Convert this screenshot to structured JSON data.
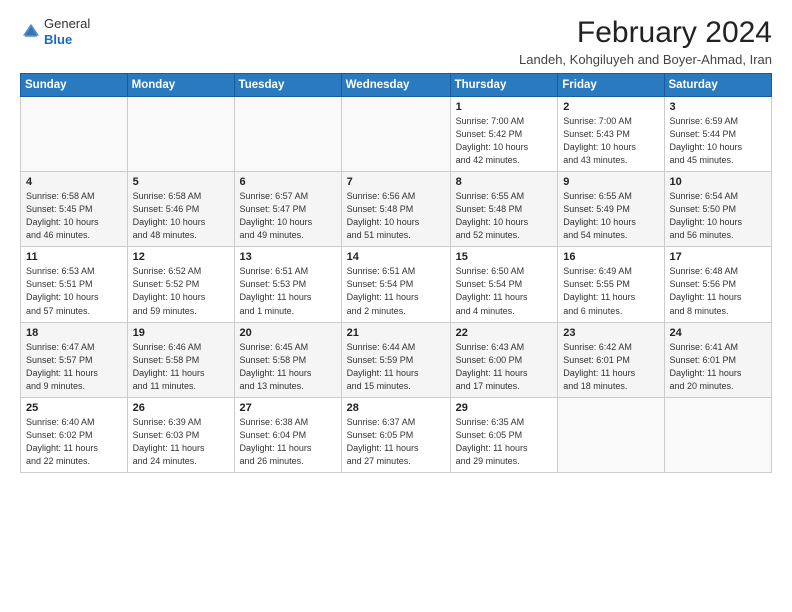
{
  "app": {
    "logo_line1": "General",
    "logo_line2": "Blue"
  },
  "header": {
    "title": "February 2024",
    "subtitle": "Landeh, Kohgiluyeh and Boyer-Ahmad, Iran"
  },
  "calendar": {
    "days_of_week": [
      "Sunday",
      "Monday",
      "Tuesday",
      "Wednesday",
      "Thursday",
      "Friday",
      "Saturday"
    ],
    "weeks": [
      [
        {
          "day": "",
          "info": ""
        },
        {
          "day": "",
          "info": ""
        },
        {
          "day": "",
          "info": ""
        },
        {
          "day": "",
          "info": ""
        },
        {
          "day": "1",
          "info": "Sunrise: 7:00 AM\nSunset: 5:42 PM\nDaylight: 10 hours\nand 42 minutes."
        },
        {
          "day": "2",
          "info": "Sunrise: 7:00 AM\nSunset: 5:43 PM\nDaylight: 10 hours\nand 43 minutes."
        },
        {
          "day": "3",
          "info": "Sunrise: 6:59 AM\nSunset: 5:44 PM\nDaylight: 10 hours\nand 45 minutes."
        }
      ],
      [
        {
          "day": "4",
          "info": "Sunrise: 6:58 AM\nSunset: 5:45 PM\nDaylight: 10 hours\nand 46 minutes."
        },
        {
          "day": "5",
          "info": "Sunrise: 6:58 AM\nSunset: 5:46 PM\nDaylight: 10 hours\nand 48 minutes."
        },
        {
          "day": "6",
          "info": "Sunrise: 6:57 AM\nSunset: 5:47 PM\nDaylight: 10 hours\nand 49 minutes."
        },
        {
          "day": "7",
          "info": "Sunrise: 6:56 AM\nSunset: 5:48 PM\nDaylight: 10 hours\nand 51 minutes."
        },
        {
          "day": "8",
          "info": "Sunrise: 6:55 AM\nSunset: 5:48 PM\nDaylight: 10 hours\nand 52 minutes."
        },
        {
          "day": "9",
          "info": "Sunrise: 6:55 AM\nSunset: 5:49 PM\nDaylight: 10 hours\nand 54 minutes."
        },
        {
          "day": "10",
          "info": "Sunrise: 6:54 AM\nSunset: 5:50 PM\nDaylight: 10 hours\nand 56 minutes."
        }
      ],
      [
        {
          "day": "11",
          "info": "Sunrise: 6:53 AM\nSunset: 5:51 PM\nDaylight: 10 hours\nand 57 minutes."
        },
        {
          "day": "12",
          "info": "Sunrise: 6:52 AM\nSunset: 5:52 PM\nDaylight: 10 hours\nand 59 minutes."
        },
        {
          "day": "13",
          "info": "Sunrise: 6:51 AM\nSunset: 5:53 PM\nDaylight: 11 hours\nand 1 minute."
        },
        {
          "day": "14",
          "info": "Sunrise: 6:51 AM\nSunset: 5:54 PM\nDaylight: 11 hours\nand 2 minutes."
        },
        {
          "day": "15",
          "info": "Sunrise: 6:50 AM\nSunset: 5:54 PM\nDaylight: 11 hours\nand 4 minutes."
        },
        {
          "day": "16",
          "info": "Sunrise: 6:49 AM\nSunset: 5:55 PM\nDaylight: 11 hours\nand 6 minutes."
        },
        {
          "day": "17",
          "info": "Sunrise: 6:48 AM\nSunset: 5:56 PM\nDaylight: 11 hours\nand 8 minutes."
        }
      ],
      [
        {
          "day": "18",
          "info": "Sunrise: 6:47 AM\nSunset: 5:57 PM\nDaylight: 11 hours\nand 9 minutes."
        },
        {
          "day": "19",
          "info": "Sunrise: 6:46 AM\nSunset: 5:58 PM\nDaylight: 11 hours\nand 11 minutes."
        },
        {
          "day": "20",
          "info": "Sunrise: 6:45 AM\nSunset: 5:58 PM\nDaylight: 11 hours\nand 13 minutes."
        },
        {
          "day": "21",
          "info": "Sunrise: 6:44 AM\nSunset: 5:59 PM\nDaylight: 11 hours\nand 15 minutes."
        },
        {
          "day": "22",
          "info": "Sunrise: 6:43 AM\nSunset: 6:00 PM\nDaylight: 11 hours\nand 17 minutes."
        },
        {
          "day": "23",
          "info": "Sunrise: 6:42 AM\nSunset: 6:01 PM\nDaylight: 11 hours\nand 18 minutes."
        },
        {
          "day": "24",
          "info": "Sunrise: 6:41 AM\nSunset: 6:01 PM\nDaylight: 11 hours\nand 20 minutes."
        }
      ],
      [
        {
          "day": "25",
          "info": "Sunrise: 6:40 AM\nSunset: 6:02 PM\nDaylight: 11 hours\nand 22 minutes."
        },
        {
          "day": "26",
          "info": "Sunrise: 6:39 AM\nSunset: 6:03 PM\nDaylight: 11 hours\nand 24 minutes."
        },
        {
          "day": "27",
          "info": "Sunrise: 6:38 AM\nSunset: 6:04 PM\nDaylight: 11 hours\nand 26 minutes."
        },
        {
          "day": "28",
          "info": "Sunrise: 6:37 AM\nSunset: 6:05 PM\nDaylight: 11 hours\nand 27 minutes."
        },
        {
          "day": "29",
          "info": "Sunrise: 6:35 AM\nSunset: 6:05 PM\nDaylight: 11 hours\nand 29 minutes."
        },
        {
          "day": "",
          "info": ""
        },
        {
          "day": "",
          "info": ""
        }
      ]
    ]
  }
}
